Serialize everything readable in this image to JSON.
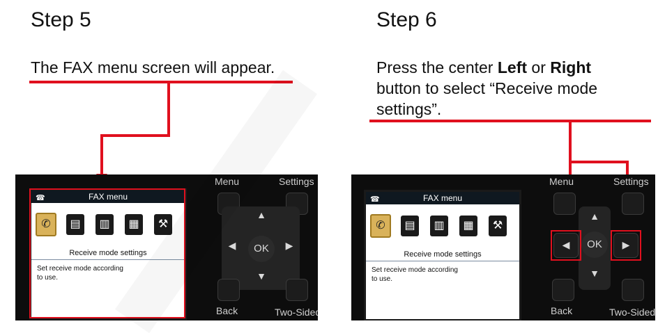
{
  "step5": {
    "title": "Step 5",
    "instruction": "The FAX menu screen will appear."
  },
  "step6": {
    "title": "Step 6",
    "instruction_prefix": "Press the center ",
    "left_word": "Left",
    "or_word": " or ",
    "right_word": "Right",
    "instruction_suffix": "button to select “Receive mode settings”."
  },
  "lcd": {
    "title": "FAX menu",
    "subtitle": "Receive mode settings",
    "description_line1": "Set receive mode according",
    "description_line2": "to use."
  },
  "panel": {
    "menu_label": "Menu",
    "settings_label": "Settings",
    "ok_label": "OK",
    "back_label": "Back",
    "two_sided_label": "Two-Sided"
  },
  "colors": {
    "annotation_red": "#e0101e",
    "selected_icon": "#d9b25a"
  },
  "icons": [
    "fax-receive-icon",
    "fax-list-icon",
    "fax-doc-icon",
    "fax-contact-icon",
    "tools-icon"
  ]
}
